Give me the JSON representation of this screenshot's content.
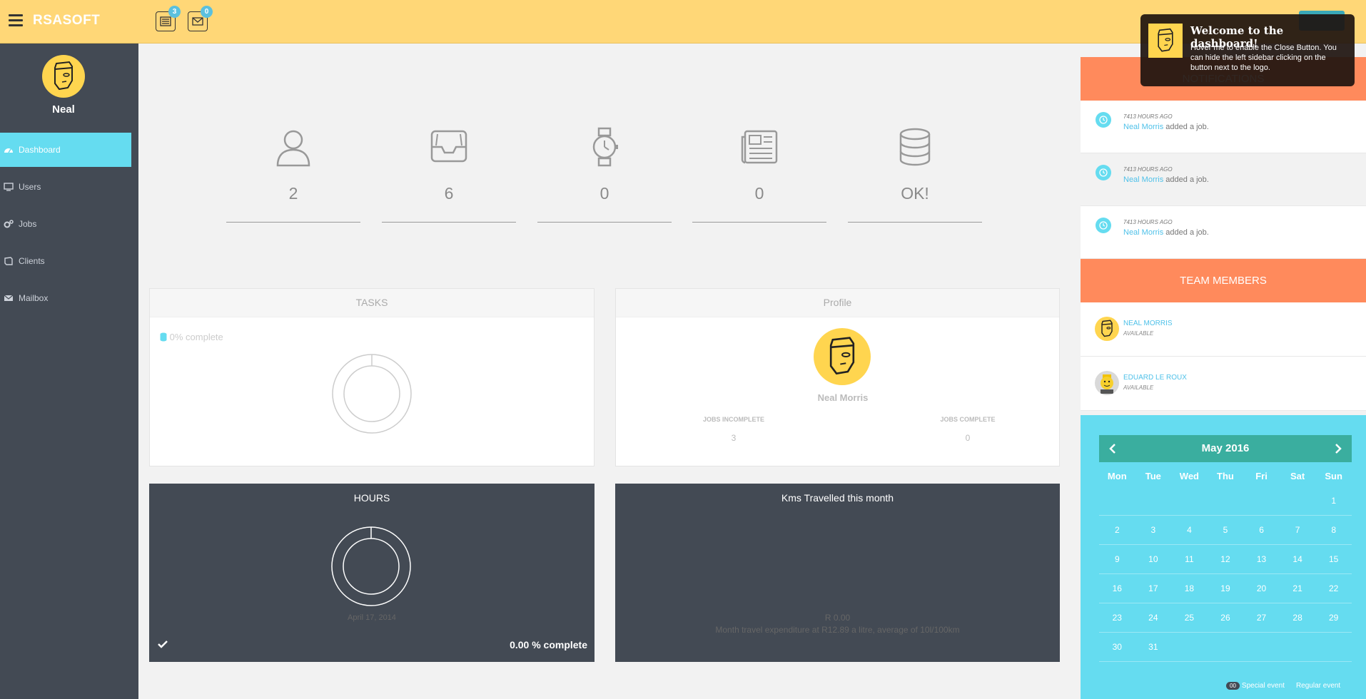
{
  "topbar": {
    "brand": "RSASOFT",
    "tasks_badge": "3",
    "mail_badge": "0"
  },
  "sidebar": {
    "username": "Neal",
    "items": [
      {
        "label": "Dashboard",
        "icon": "dashboard-icon",
        "active": true
      },
      {
        "label": "Users",
        "icon": "desktop-icon"
      },
      {
        "label": "Jobs",
        "icon": "cogs-icon"
      },
      {
        "label": "Clients",
        "icon": "book-icon"
      },
      {
        "label": "Mailbox",
        "icon": "envelope-icon"
      }
    ]
  },
  "stats": [
    {
      "icon": "user-icon",
      "value": "2"
    },
    {
      "icon": "inbox-icon",
      "value": "6"
    },
    {
      "icon": "watch-icon",
      "value": "0"
    },
    {
      "icon": "newspaper-icon",
      "value": "0"
    },
    {
      "icon": "database-icon",
      "value": "OK!"
    }
  ],
  "tasks_panel": {
    "title": "TASKS",
    "progress": "0% complete",
    "progress_value": 0
  },
  "profile_panel": {
    "title": "Profile",
    "name": "Neal Morris",
    "incomplete_label": "JOBS INCOMPLETE",
    "incomplete_value": "3",
    "complete_label": "JOBS COMPLETE",
    "complete_value": "0"
  },
  "hours_panel": {
    "title": "HOURS",
    "date": "April 17, 2014",
    "complete": "0.00 % complete",
    "progress_value": 0
  },
  "kms_panel": {
    "title": "Kms Travelled this month",
    "amount": "R 0.00",
    "description": "Month travel expenditure at R12.89 a litre, average of 10l/100km"
  },
  "notifications": {
    "title": "NOTIFICATIONS",
    "items": [
      {
        "time": "7413 HOURS AGO",
        "user": "Neal Morris",
        "action": "added a job."
      },
      {
        "time": "7413 HOURS AGO",
        "user": "Neal Morris",
        "action": "added a job."
      },
      {
        "time": "7413 HOURS AGO",
        "user": "Neal Morris",
        "action": "added a job."
      }
    ]
  },
  "team": {
    "title": "TEAM MEMBERS",
    "members": [
      {
        "name": "NEAL MORRIS",
        "status": "AVAILABLE"
      },
      {
        "name": "EDUARD LE ROUX",
        "status": "AVAILABLE"
      }
    ]
  },
  "calendar": {
    "month": "May 2016",
    "days_of_week": [
      "Mon",
      "Tue",
      "Wed",
      "Thu",
      "Fri",
      "Sat",
      "Sun"
    ],
    "weeks": [
      [
        "",
        "",
        "",
        "",
        "",
        "",
        "1"
      ],
      [
        "2",
        "3",
        "4",
        "5",
        "6",
        "7",
        "8"
      ],
      [
        "9",
        "10",
        "11",
        "12",
        "13",
        "14",
        "15"
      ],
      [
        "16",
        "17",
        "18",
        "19",
        "20",
        "21",
        "22"
      ],
      [
        "23",
        "24",
        "25",
        "26",
        "27",
        "28",
        "29"
      ],
      [
        "30",
        "31",
        "",
        "",
        "",
        "",
        ""
      ]
    ],
    "legend_badge": "00",
    "legend_special": "Special event",
    "legend_regular": "Regular event"
  },
  "popup": {
    "title": "Welcome to the dashboard!",
    "body": "Hover me to enable the Close Button. You can hide the left sidebar clicking on the button next to the logo."
  },
  "colors": {
    "topbar": "#ffd777",
    "sidebar": "#434a54",
    "accent": "#65dcf0",
    "orange": "#ff8a5c",
    "calendar_head": "#3aae9f"
  }
}
